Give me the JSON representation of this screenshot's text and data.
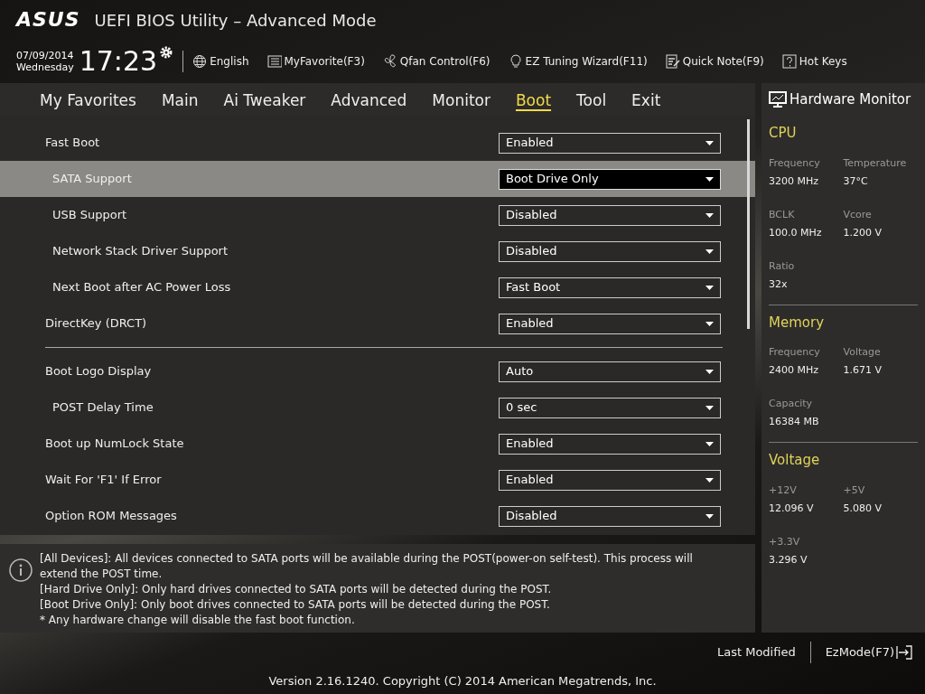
{
  "header": {
    "logo": "ASUS",
    "title": "UEFI BIOS Utility – Advanced Mode",
    "date": "07/09/2014",
    "weekday": "Wednesday",
    "time": "17:23",
    "tools": [
      {
        "kind": "globe",
        "label": "English"
      },
      {
        "kind": "list",
        "label": "MyFavorite(F3)"
      },
      {
        "kind": "fan",
        "label": "Qfan Control(F6)"
      },
      {
        "kind": "bulb",
        "label": "EZ Tuning Wizard(F11)"
      },
      {
        "kind": "note",
        "label": "Quick Note(F9)"
      },
      {
        "kind": "help",
        "label": "Hot Keys"
      }
    ]
  },
  "tabs": [
    {
      "label": "My Favorites",
      "selected": false
    },
    {
      "label": "Main",
      "selected": false
    },
    {
      "label": "Ai Tweaker",
      "selected": false
    },
    {
      "label": "Advanced",
      "selected": false
    },
    {
      "label": "Monitor",
      "selected": false
    },
    {
      "label": "Boot",
      "selected": true
    },
    {
      "label": "Tool",
      "selected": false
    },
    {
      "label": "Exit",
      "selected": false
    }
  ],
  "sections": [
    [
      {
        "label": "Fast Boot",
        "value": "Enabled",
        "selected": false,
        "children": [
          {
            "label": "SATA Support",
            "value": "Boot Drive Only",
            "selected": true
          },
          {
            "label": "USB Support",
            "value": "Disabled",
            "selected": false
          },
          {
            "label": "Network Stack Driver Support",
            "value": "Disabled",
            "selected": false
          },
          {
            "label": "Next Boot after AC Power Loss",
            "value": "Fast Boot",
            "selected": false
          }
        ]
      },
      {
        "label": "DirectKey (DRCT)",
        "value": "Enabled",
        "selected": false
      }
    ],
    [
      {
        "label": "Boot Logo Display",
        "value": "Auto",
        "selected": false,
        "children": [
          {
            "label": "POST Delay Time",
            "value": "0 sec",
            "selected": false
          }
        ]
      },
      {
        "label": "Boot up NumLock State",
        "value": "Enabled",
        "selected": false
      },
      {
        "label": "Wait For 'F1' If Error",
        "value": "Enabled",
        "selected": false
      },
      {
        "label": "Option ROM Messages",
        "value": "Disabled",
        "selected": false
      }
    ]
  ],
  "help": [
    "[All Devices]: All devices connected to SATA ports will be available during the POST(power-on self-test). This process will extend the POST time.",
    "[Hard Drive Only]: Only hard drives connected to SATA ports will be detected during the POST.",
    "[Boot Drive Only]: Only boot drives connected to SATA ports will be detected during the POST.",
    "* Any hardware change will disable the fast boot function."
  ],
  "hardware_monitor": {
    "title": "Hardware Monitor",
    "groups": [
      {
        "title": "CPU",
        "stats": [
          {
            "label": "Frequency",
            "value": "3200 MHz"
          },
          {
            "label": "Temperature",
            "value": "37°C"
          },
          {
            "label": "BCLK",
            "value": "100.0 MHz"
          },
          {
            "label": "Vcore",
            "value": "1.200 V"
          },
          {
            "label": "Ratio",
            "value": "32x"
          }
        ]
      },
      {
        "title": "Memory",
        "stats": [
          {
            "label": "Frequency",
            "value": "2400 MHz"
          },
          {
            "label": "Voltage",
            "value": "1.671 V"
          },
          {
            "label": "Capacity",
            "value": "16384 MB"
          }
        ]
      },
      {
        "title": "Voltage",
        "stats": [
          {
            "label": "+12V",
            "value": "12.096 V"
          },
          {
            "label": "+5V",
            "value": "5.080 V"
          },
          {
            "label": "+3.3V",
            "value": "3.296 V"
          }
        ]
      }
    ]
  },
  "footer": {
    "last_modified": "Last Modified",
    "ez_mode": "EzMode(F7)",
    "version": "Version 2.16.1240. Copyright (C) 2014 American Megatrends, Inc."
  }
}
